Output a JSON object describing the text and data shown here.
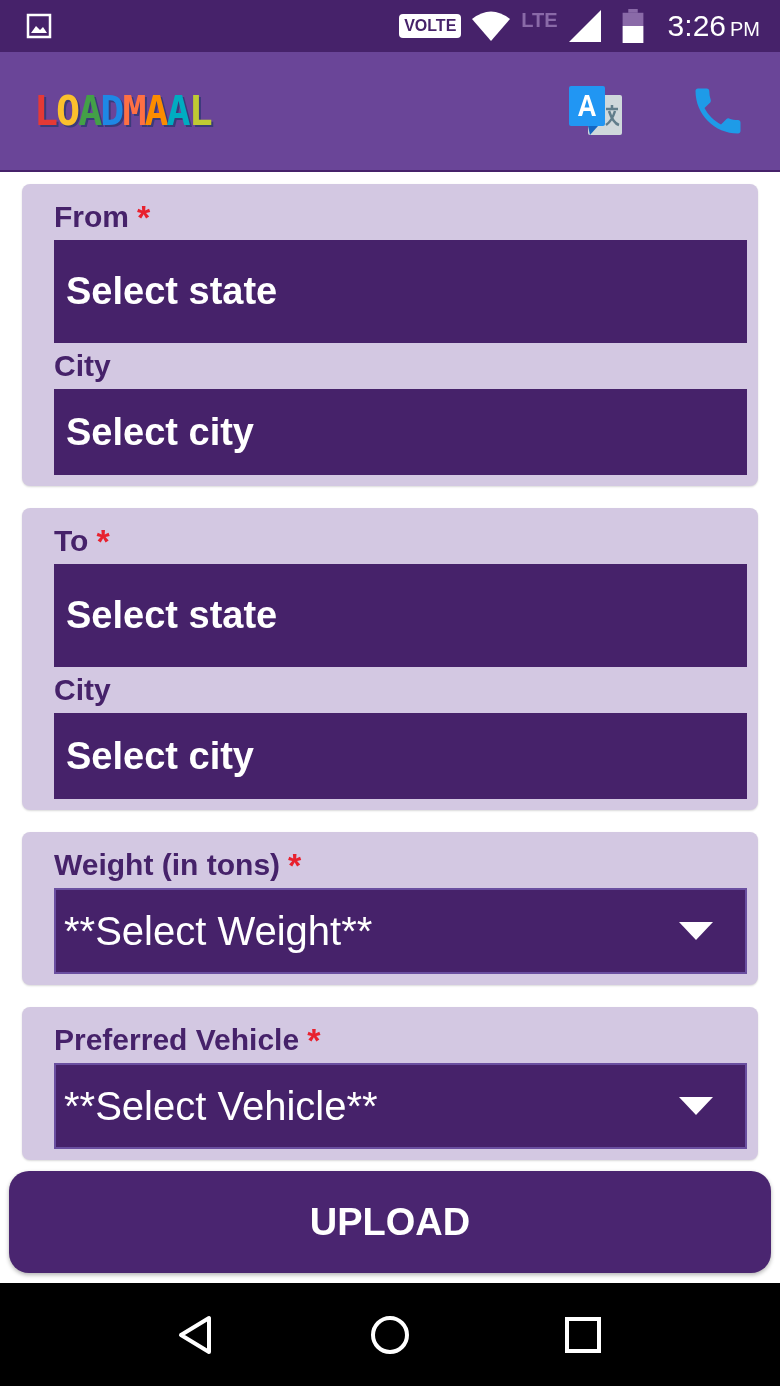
{
  "status_bar": {
    "volte": "VOLTE",
    "network": "LTE",
    "time": "3:26",
    "ampm": "PM"
  },
  "app_bar": {
    "logo": "LOADMAAL"
  },
  "sections": [
    {
      "kind": "location",
      "label": "From",
      "required_mark": "*",
      "state_field": "Select state",
      "city_label": "City",
      "city_field": "Select city"
    },
    {
      "kind": "location",
      "label": "To",
      "required_mark": "*",
      "state_field": "Select state",
      "city_label": "City",
      "city_field": "Select city"
    },
    {
      "kind": "dropdown",
      "label": "Weight (in tons)",
      "required_mark": "*",
      "value": "**Select Weight**"
    },
    {
      "kind": "dropdown",
      "label": "Preferred Vehicle",
      "required_mark": "*",
      "value": "**Select Vehicle**"
    }
  ],
  "upload_button": "UPLOAD"
}
